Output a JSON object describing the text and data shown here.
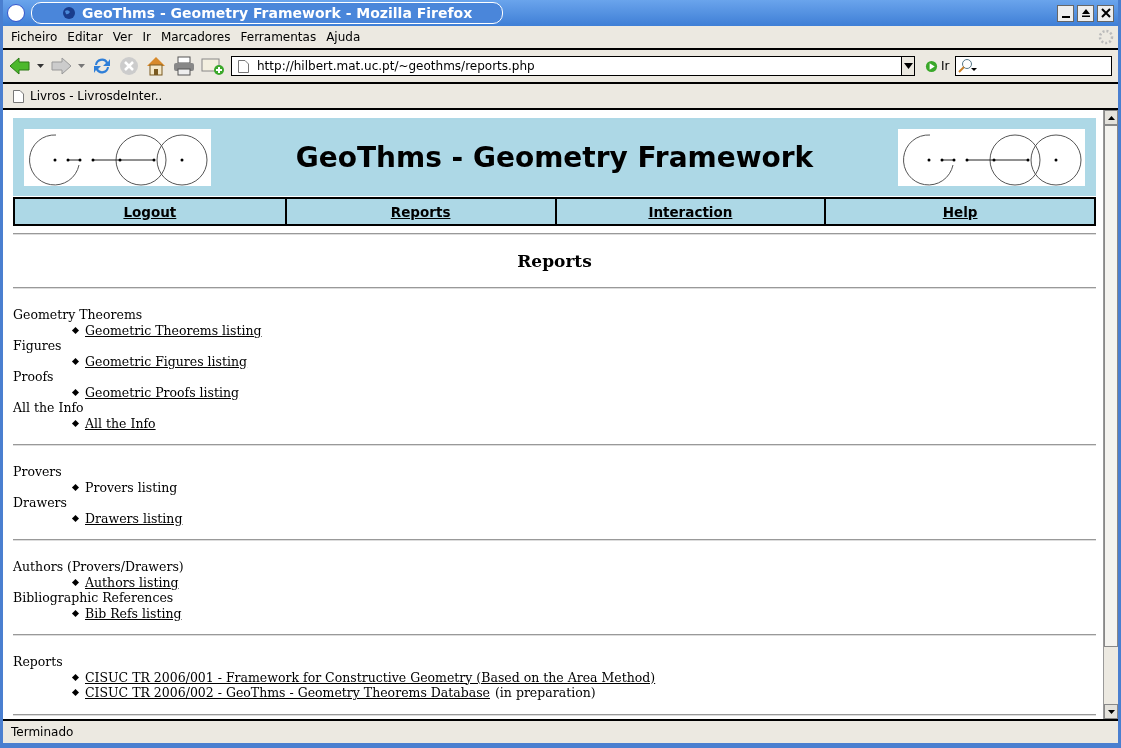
{
  "window": {
    "title": "GeoThms - Geometry Framework - Mozilla Firefox"
  },
  "menu": [
    "Ficheiro",
    "Editar",
    "Ver",
    "Ir",
    "Marcadores",
    "Ferramentas",
    "Ajuda"
  ],
  "address_bar": {
    "value": "http://hilbert.mat.uc.pt/~geothms/reports.php",
    "go_label": "Ir"
  },
  "bookmarks": [
    "Livros - LivrosdeInter.."
  ],
  "page": {
    "title": "GeoThms - Geometry Framework",
    "nav": [
      "Logout",
      "Reports",
      "Interaction",
      "Help"
    ],
    "heading": "Reports",
    "sections": [
      {
        "groups": [
          {
            "label": "Geometry Theorems",
            "items": [
              {
                "text": "Geometric Theorems listing",
                "link": true
              }
            ]
          },
          {
            "label": "Figures",
            "items": [
              {
                "text": "Geometric Figures listing",
                "link": true
              }
            ]
          },
          {
            "label": "Proofs",
            "items": [
              {
                "text": "Geometric Proofs listing",
                "link": true
              }
            ]
          },
          {
            "label": "All the Info",
            "items": [
              {
                "text": "All the Info",
                "link": true
              }
            ]
          }
        ]
      },
      {
        "groups": [
          {
            "label": "Provers",
            "items": [
              {
                "text": "Provers listing",
                "link": false
              }
            ]
          },
          {
            "label": "Drawers",
            "items": [
              {
                "text": "Drawers listing",
                "link": true
              }
            ]
          }
        ]
      },
      {
        "groups": [
          {
            "label": "Authors (Provers/Drawers)",
            "items": [
              {
                "text": "Authors listing",
                "link": true
              }
            ]
          },
          {
            "label": "Bibliographic References",
            "items": [
              {
                "text": "Bib Refs listing",
                "link": true
              }
            ]
          }
        ]
      },
      {
        "groups": [
          {
            "label": "Reports",
            "items": [
              {
                "text": "CISUC TR 2006/001 - Framework for Constructive Geometry (Based on the Area Method)",
                "link": true
              },
              {
                "text": "CISUC TR 2006/002 - GeoThms - Geometry Theorems Database",
                "link": true,
                "note": "(in preparation)"
              }
            ]
          }
        ]
      }
    ]
  },
  "status_bar": {
    "text": "Terminado"
  }
}
